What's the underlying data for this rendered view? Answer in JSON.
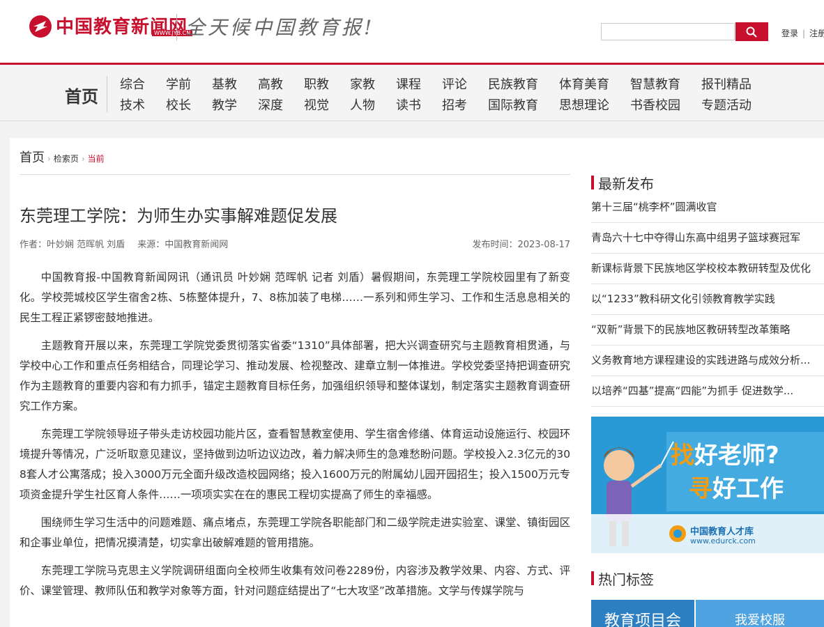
{
  "header": {
    "logo_text": "中国教育新闻网",
    "logo_url": "WWW.JYB.CN",
    "slogan": "全天候中国教育报!",
    "search": {
      "placeholder": ""
    },
    "login_label": "登录",
    "separator": "|",
    "register_label": "注册"
  },
  "nav": {
    "home_label": "首页",
    "row1": [
      "综合",
      "学前",
      "基教",
      "高教",
      "职教",
      "家教",
      "课程",
      "评论",
      "民族教育",
      "体育美育",
      "智慧教育",
      "报刊精品"
    ],
    "row2": [
      "技术",
      "校长",
      "教学",
      "深度",
      "视觉",
      "人物",
      "读书",
      "招考",
      "国际教育",
      "思想理论",
      "书香校园",
      "专题活动"
    ]
  },
  "breadcrumb": {
    "home": "首页",
    "search": "检索页",
    "current": "当前"
  },
  "article": {
    "title": "东莞理工学院：为师生办实事解难题促发展",
    "author": "作者：叶妙娴 范晖帆 刘盾",
    "source": "来源：中国教育新闻网",
    "date": "发布时间：2023-08-17",
    "paragraphs": [
      "中国教育报-中国教育新闻网讯（通讯员 叶妙娴 范晖帆 记者 刘盾）暑假期间，东莞理工学院校园里有了新变化。学校莞城校区学生宿舍2栋、5栋整体提升，7、8栋加装了电梯……一系列和师生学习、工作和生活息息相关的民生工程正紧锣密鼓地推进。",
      "主题教育开展以来，东莞理工学院党委贯彻落实省委“1310”具体部署，把大兴调查研究与主题教育相贯通，与学校中心工作和重点任务相结合，同理论学习、推动发展、检视整改、建章立制一体推进。学校党委坚持把调查研究作为主题教育的重要内容和有力抓手，锚定主题教育目标任务，加强组织领导和整体谋划，制定落实主题教育调查研究工作方案。",
      "东莞理工学院领导班子带头走访校园功能片区，查看智慧教室使用、学生宿舍修缮、体育运动设施运行、校园环境提升等情况，广泛听取意见建议，坚持做到边听边议边改，着力解决师生的急难愁盼问题。学校投入2.3亿元的308套人才公寓落成；投入3000万元全面升级改造校园网络；投入1600万元的附属幼儿园开园招生；投入1500万元专项资金提升学生社区育人条件……一项项实实在在的惠民工程切实提高了师生的幸福感。",
      "围绕师生学习生活中的问题难题、痛点堵点，东莞理工学院各职能部门和二级学院走进实验室、课堂、镇街园区和企事业单位，把情况摸清楚，切实拿出破解难题的管用措施。",
      "东莞理工学院马克思主义学院调研组面向全校师生收集有效问卷2289份，内容涉及教学效果、内容、方式、评价、课堂管理、教师队伍和教学对象等方面，针对问题症结提出了“七大攻坚”改革措施。文学与传媒学院与"
    ]
  },
  "sidebar": {
    "latest_title": "最新发布",
    "latest": [
      "第十三届“桃李杯”圆满收官",
      "青岛六十七中夺得山东高中组男子篮球赛冠军",
      "新课标背景下民族地区学校校本教研转型及优化",
      "以“1233”教科研文化引领教育教学实践",
      "“双新”背景下的民族地区教研转型改革策略",
      "义务教育地方课程建设的实践进路与成效分析...",
      "以培养“四基”提高“四能”为抓手 促进数学..."
    ],
    "ad": {
      "line1_a": "找",
      "line1_b": "好老师?",
      "line2_a": "寻",
      "line2_b": "好工作",
      "brand": "中国教育人才库",
      "url": "www.edurck.com"
    },
    "tags_title": "热门标签",
    "tags": [
      "教育项目会",
      "我爱校服"
    ]
  },
  "colors": {
    "accent": "#c8102e",
    "ad_bg": "#2a9ad6"
  }
}
